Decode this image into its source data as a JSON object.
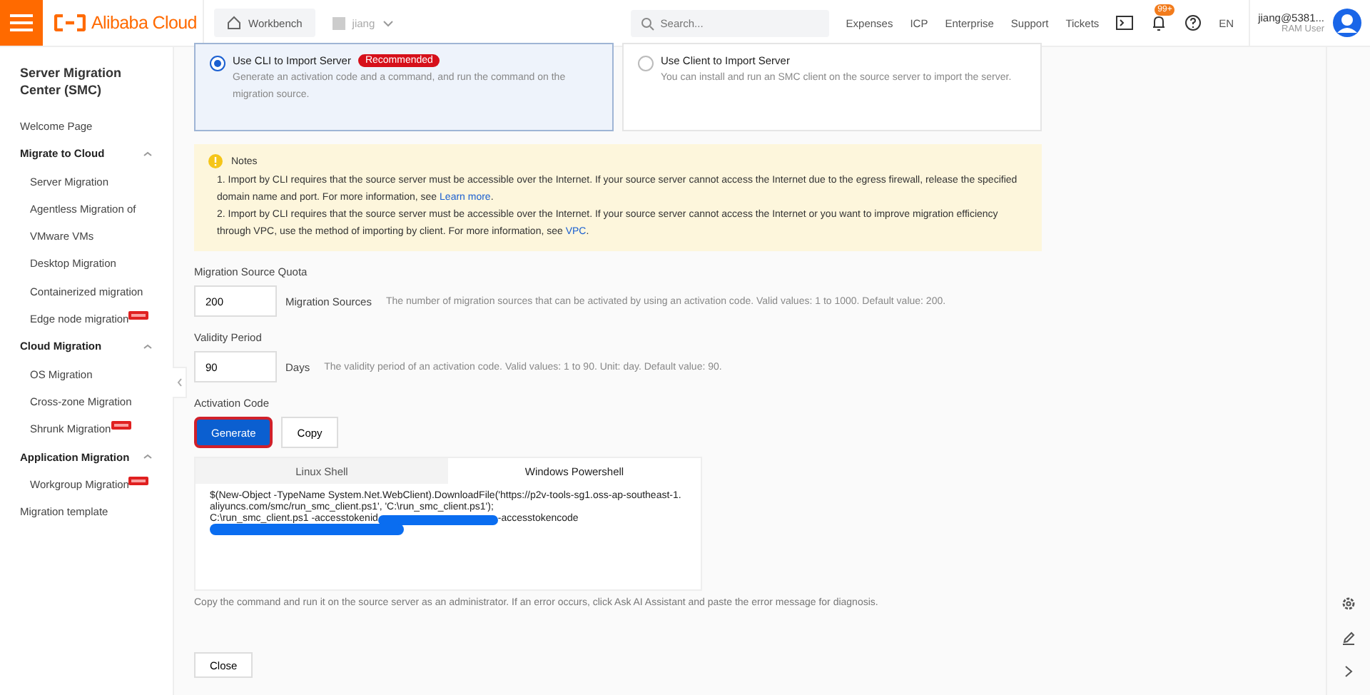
{
  "header": {
    "brand": "Alibaba Cloud",
    "workbench": "Workbench",
    "resource_group": "jiang",
    "search": {
      "placeholder": "Search..."
    },
    "links": [
      "Expenses",
      "ICP",
      "Enterprise",
      "Support",
      "Tickets"
    ],
    "notification_count": "99+",
    "language": "EN",
    "user": {
      "name": "jiang@5381...",
      "role": "RAM User"
    }
  },
  "sidebar": {
    "title": "Server Migration Center (SMC)",
    "items": [
      {
        "kind": "link",
        "label": "Welcome Page"
      },
      {
        "kind": "group",
        "label": "Migrate to Cloud",
        "expanded": true,
        "children": [
          {
            "label": "Server Migration",
            "new": false
          },
          {
            "label": "Agentless Migration of",
            "new": false
          },
          {
            "label": "VMware VMs",
            "new": false
          },
          {
            "label": "Desktop Migration",
            "new": false
          },
          {
            "label": "Containerized migration",
            "new": false
          },
          {
            "label": "Edge node migration",
            "new": true
          }
        ]
      },
      {
        "kind": "group",
        "label": "Cloud Migration",
        "expanded": true,
        "children": [
          {
            "label": "OS Migration",
            "new": false
          },
          {
            "label": "Cross-zone Migration",
            "new": false
          },
          {
            "label": "Shrunk Migration",
            "new": true
          }
        ]
      },
      {
        "kind": "group",
        "label": "Application Migration",
        "expanded": true,
        "children": [
          {
            "label": "Workgroup Migration",
            "new": true
          }
        ]
      },
      {
        "kind": "link",
        "label": "Migration template"
      }
    ]
  },
  "import_methods": [
    {
      "title": "Use CLI to Import Server",
      "badge": "Recommended",
      "description": "Generate an activation code and a command, and run the command on the migration source.",
      "selected": true
    },
    {
      "title": "Use Client to Import Server",
      "description": "You can install and run an SMC client on the source server to import the server.",
      "selected": false
    }
  ],
  "notes": {
    "title": "Notes",
    "items": [
      {
        "text": "1. Import by CLI requires that the source server must be accessible over the Internet. If your source server cannot access the Internet due to the egress firewall, release the specified domain name and port. For more information, see",
        "link": "Learn more",
        "end": "."
      },
      {
        "text": "2. Import by CLI requires that the source server must be accessible over the Internet. If your source server cannot access the Internet or you want to improve migration efficiency through VPC, use the method of importing by client. For more information, see",
        "link": "VPC",
        "end": "."
      }
    ]
  },
  "quota": {
    "label": "Migration Source Quota",
    "value": "200",
    "unit": "Migration Sources",
    "hint": "The number of migration sources that can be activated by using an activation code. Valid values: 1 to 1000. Default value: 200."
  },
  "validity": {
    "label": "Validity Period",
    "value": "90",
    "unit": "Days",
    "hint": "The validity period of an activation code. Valid values: 1 to 90. Unit: day. Default value: 90."
  },
  "activation": {
    "label": "Activation Code",
    "buttons": [
      "Generate",
      "Copy"
    ],
    "tabs": [
      {
        "label": "Linux Shell",
        "selected": false
      },
      {
        "label": "Windows Powershell",
        "selected": true
      }
    ],
    "command": "$(New-Object -TypeName System.Net.WebClient).DownloadFile('https://p2v-tools-sg1.oss-ap-southeast-1.aliyuncs.com/smc/run_smc_client.ps1', 'C:\\run_smc_client.ps1');",
    "command_line2": "C:\\run_smc_client.ps1 -accesstokenid",
    "command_line2_end": "-accesstokencode",
    "hint": "Copy the command and run it on the source server as an administrator. If an error occurs, click Ask AI Assistant and paste the error message for diagnosis."
  },
  "close_button": "Close"
}
